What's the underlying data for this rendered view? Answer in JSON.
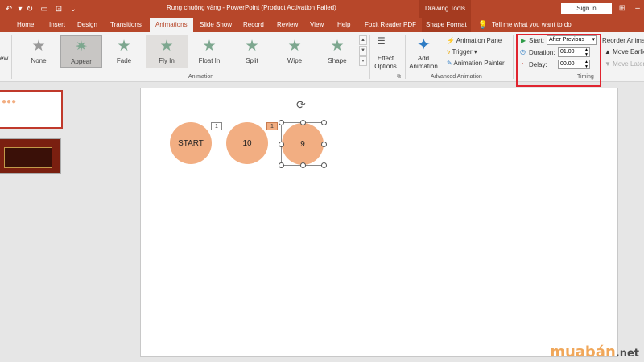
{
  "titlebar": {
    "title": "Rung chuông vàng  -  PowerPoint (Product Activation Failed)",
    "drawing_tools": "Drawing Tools",
    "signin": "Sign in",
    "icons": [
      "undo-icon",
      "undo-dropdown-icon",
      "redo-icon",
      "from-beginning-icon",
      "touch-mode-icon",
      "more-commands-icon"
    ]
  },
  "tabs": {
    "items": [
      "Home",
      "Insert",
      "Design",
      "Transitions",
      "Animations",
      "Slide Show",
      "Record",
      "Review",
      "View",
      "Help",
      "Foxit Reader PDF",
      "Shape Format"
    ],
    "active": "Animations",
    "tellme": "Tell me what you want to do"
  },
  "ribbon": {
    "preview_label": "ew",
    "animations": [
      "None",
      "Appear",
      "Fade",
      "Fly In",
      "Float In",
      "Split",
      "Wipe",
      "Shape"
    ],
    "selected_animation": "Appear",
    "effect_options": "Effect Options",
    "animation_group_label": "Animation",
    "add_animation": "Add Animation",
    "animation_pane": "Animation Pane",
    "trigger": "Trigger",
    "animation_painter": "Animation Painter",
    "advanced_group_label": "Advanced Animation",
    "timing": {
      "start_label": "Start:",
      "start_value": "After Previous",
      "duration_label": "Duration:",
      "duration_value": "01.00",
      "delay_label": "Delay:",
      "delay_value": "00.00",
      "group_label": "Timing"
    },
    "reorder_label": "Reorder Animat",
    "move_earlier": "Move Earlie",
    "move_later": "Move Later"
  },
  "slide": {
    "circles": [
      {
        "label": "START"
      },
      {
        "label": "10",
        "badge": "1"
      },
      {
        "label": "9",
        "badge": "1"
      }
    ]
  },
  "watermark": {
    "main": "muabán",
    "tld": ".net"
  },
  "colors": {
    "accent": "#b7472a",
    "circle": "#f2ae82",
    "highlight_box": "#e0242f"
  }
}
